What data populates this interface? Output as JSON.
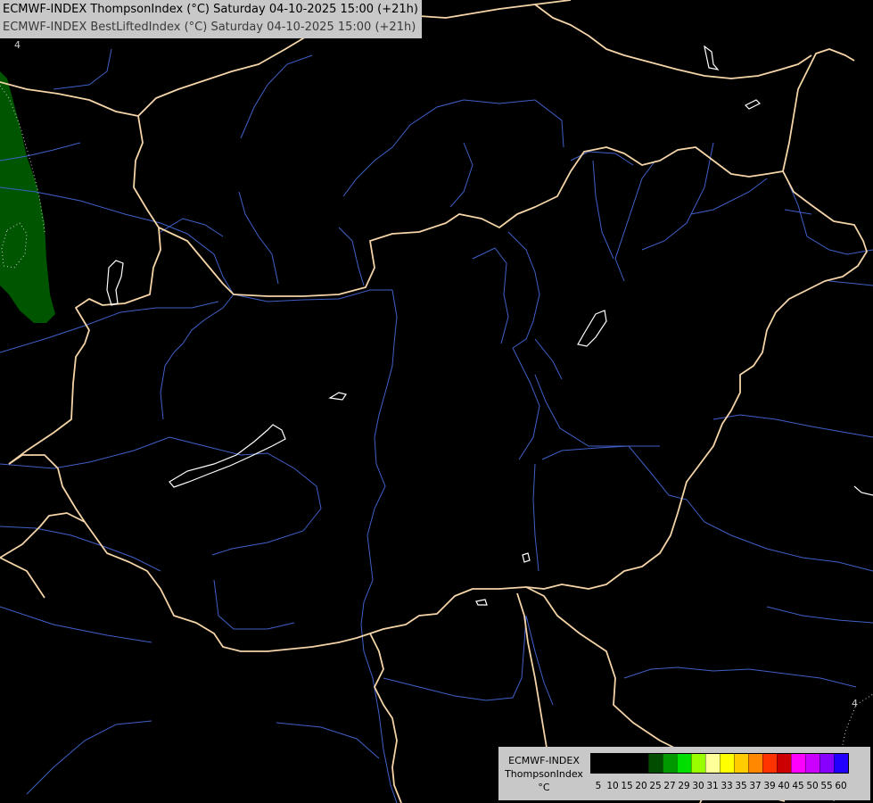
{
  "title": {
    "line1": "ECMWF-INDEX ThompsonIndex (°C) Saturday 04-10-2025 15:00 (+21h)",
    "line2": "ECMWF-INDEX BestLiftedIndex (°C) Saturday 04-10-2025 15:00 (+21h)"
  },
  "contour_labels": {
    "top_left": "4",
    "bottom_right": "4"
  },
  "legend": {
    "title_line1": "ECMWF-INDEX",
    "title_line2": "ThompsonIndex",
    "title_line3": "°C",
    "swatches": [
      {
        "color": "#000000"
      },
      {
        "color": "#000000"
      },
      {
        "color": "#000000"
      },
      {
        "color": "#000000"
      },
      {
        "color": "#004d00"
      },
      {
        "color": "#009900"
      },
      {
        "color": "#00dd00"
      },
      {
        "color": "#99ff00"
      },
      {
        "color": "#ffff99"
      },
      {
        "color": "#ffff00"
      },
      {
        "color": "#ffcc00"
      },
      {
        "color": "#ff8800"
      },
      {
        "color": "#ff3300"
      },
      {
        "color": "#cc0000"
      },
      {
        "color": "#ff00ff"
      },
      {
        "color": "#cc00ff"
      },
      {
        "color": "#8800ff"
      },
      {
        "color": "#2200ff"
      }
    ],
    "ticks": [
      "5",
      "10",
      "15",
      "20",
      "25",
      "27",
      "29",
      "30",
      "31",
      "33",
      "35",
      "37",
      "39",
      "40",
      "45",
      "50",
      "55",
      "60"
    ]
  },
  "colors": {
    "border": "#f5d4a8",
    "river": "#4060c8",
    "lake_outline": "#ffffff",
    "index_field": "#005500"
  }
}
